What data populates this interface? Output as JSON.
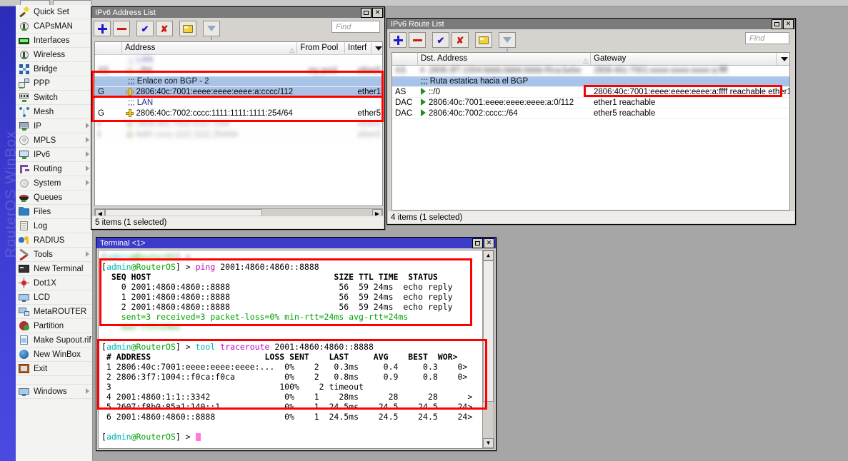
{
  "desktop": {
    "watermark": "RouterOS WinBox"
  },
  "sidebar": {
    "items": [
      {
        "label": "Quick Set",
        "icon": "wand-icon",
        "arrow": false
      },
      {
        "label": "CAPsMAN",
        "icon": "disc-icon",
        "arrow": false
      },
      {
        "label": "Interfaces",
        "icon": "network-card-icon",
        "arrow": false
      },
      {
        "label": "Wireless",
        "icon": "disc-icon",
        "arrow": false
      },
      {
        "label": "Bridge",
        "icon": "bridge-icon",
        "arrow": false
      },
      {
        "label": "PPP",
        "icon": "ppp-icon",
        "arrow": false
      },
      {
        "label": "Switch",
        "icon": "switch-icon",
        "arrow": false
      },
      {
        "label": "Mesh",
        "icon": "mesh-icon",
        "arrow": false
      },
      {
        "label": "IP",
        "icon": "ip-icon",
        "arrow": true
      },
      {
        "label": "MPLS",
        "icon": "mpls-icon",
        "arrow": true
      },
      {
        "label": "IPv6",
        "icon": "ipv6-icon",
        "arrow": true
      },
      {
        "label": "Routing",
        "icon": "routing-icon",
        "arrow": true
      },
      {
        "label": "System",
        "icon": "system-icon",
        "arrow": true
      },
      {
        "label": "Queues",
        "icon": "queues-icon",
        "arrow": false
      },
      {
        "label": "Files",
        "icon": "files-icon",
        "arrow": false
      },
      {
        "label": "Log",
        "icon": "log-icon",
        "arrow": false
      },
      {
        "label": "RADIUS",
        "icon": "radius-icon",
        "arrow": false
      },
      {
        "label": "Tools",
        "icon": "tools-icon",
        "arrow": true
      },
      {
        "label": "New Terminal",
        "icon": "terminal-icon",
        "arrow": false
      },
      {
        "label": "Dot1X",
        "icon": "dot1x-icon",
        "arrow": false
      },
      {
        "label": "LCD",
        "icon": "lcd-icon",
        "arrow": false
      },
      {
        "label": "MetaROUTER",
        "icon": "metarouter-icon",
        "arrow": false
      },
      {
        "label": "Partition",
        "icon": "partition-icon",
        "arrow": false
      },
      {
        "label": "Make Supout.rif",
        "icon": "supout-icon",
        "arrow": false
      },
      {
        "label": "New WinBox",
        "icon": "winbox-icon",
        "arrow": false
      },
      {
        "label": "Exit",
        "icon": "exit-icon",
        "arrow": false
      },
      {
        "label": "Windows",
        "icon": "windows-icon",
        "arrow": true
      }
    ]
  },
  "address_window": {
    "title": "IPv6 Address List",
    "toolbar": {
      "add": "+",
      "remove": "-",
      "enable": "✔",
      "disable": "✘",
      "comment": "comment-folder",
      "filter": "filter-funnel",
      "find_placeholder": "Find"
    },
    "columns": [
      "",
      "Address",
      "From Pool",
      "Interf"
    ],
    "rows": [
      {
        "type": "comment",
        "flags": "",
        "text": ";;; LAN",
        "blur": true
      },
      {
        "type": "data",
        "flags": "XS",
        "address": "::/64",
        "pool": "my pool",
        "iface": "ether5",
        "blur": true,
        "sel": false
      },
      {
        "type": "comment",
        "flags": "",
        "text": ";;; Enlace con BGP - 2",
        "blur": false,
        "sel": true
      },
      {
        "type": "data",
        "flags": "G",
        "address": "2806:40c:7001:eeee:eeee:eeee:a:cccc/112",
        "pool": "",
        "iface": "ether1",
        "blur": false,
        "sel": true
      },
      {
        "type": "comment",
        "flags": "",
        "text": ";;; LAN",
        "blur": false,
        "sel": false
      },
      {
        "type": "data",
        "flags": "G",
        "address": "2806:40c:7002:cccc:1111:1111:1111:254/64",
        "pool": "",
        "iface": "ether5",
        "blur": false,
        "sel": false
      },
      {
        "type": "data",
        "flags": "I",
        "address": "",
        "pool": "",
        "iface": "",
        "blur": true,
        "sel": false
      },
      {
        "type": "data",
        "flags": "I",
        "address": "",
        "pool": "",
        "iface": "",
        "blur": true,
        "sel": false
      }
    ],
    "status": "5 items (1 selected)"
  },
  "route_window": {
    "title": "IPv6 Route List",
    "toolbar": {
      "find_placeholder": "Find"
    },
    "columns": [
      "",
      "Dst. Address",
      "Gateway"
    ],
    "rows": [
      {
        "type": "data",
        "flags": "XS",
        "dst": "2806:3f7:1004:bbbb:bbbb:bbbb:f0ca:bebe",
        "gw": "2806:40c:7001:eeee:eeee:eeee:a:ffff",
        "blur": true,
        "sel": false,
        "tri": "gray"
      },
      {
        "type": "comment",
        "text": ";;; Ruta estatica hacia el BGP",
        "sel": true
      },
      {
        "type": "data",
        "flags": "AS",
        "dst": "::/0",
        "gw": "2806:40c:7001:eeee:eeee:eeee:a:ffff reachable ether1",
        "blur": false,
        "sel": false,
        "tri": "green"
      },
      {
        "type": "data",
        "flags": "DAC",
        "dst": "2806:40c:7001:eeee:eeee:eeee:a:0/112",
        "gw": "ether1 reachable",
        "blur": false,
        "sel": false,
        "tri": "green"
      },
      {
        "type": "data",
        "flags": "DAC",
        "dst": "2806:40c:7002:cccc::/64",
        "gw": "ether5 reachable",
        "blur": false,
        "sel": false,
        "tri": "green"
      }
    ],
    "status": "4 items (1 selected)"
  },
  "terminal": {
    "title": "Terminal <1>",
    "lines": [
      {
        "kind": "prompt_cmd",
        "prompt": "[admin@RouterOS] > ",
        "cmd": "",
        "args": "",
        "blur": true
      },
      {
        "kind": "prompt_cmd",
        "prompt": "[admin@RouterOS] > ",
        "cmd": "ping",
        "args": " 2001:4860:4860::8888"
      },
      {
        "kind": "header",
        "text": "  SEQ HOST                                     SIZE TTL TIME  STATUS"
      },
      {
        "kind": "plain",
        "text": "    0 2001:4860:4860::8888                      56  59 24ms  echo reply"
      },
      {
        "kind": "plain",
        "text": "    1 2001:4860:4860::8888                      56  59 24ms  echo reply"
      },
      {
        "kind": "plain",
        "text": "    2 2001:4860:4860::8888                      56  59 24ms  echo reply"
      },
      {
        "kind": "stat",
        "text": "    sent=3 received=3 packet-loss=0% min-rtt=24ms avg-rtt=24ms"
      },
      {
        "kind": "stat",
        "text": "    max-rtt=24ms"
      },
      {
        "kind": "blank",
        "text": ""
      },
      {
        "kind": "prompt_cmd",
        "prompt": "[admin@RouterOS] > ",
        "cmd": "tool",
        "cmd2": "traceroute",
        "args": " 2001:4860:4860::8888"
      },
      {
        "kind": "header",
        "text": " # ADDRESS                       LOSS SENT    LAST     AVG    BEST  WOR>"
      },
      {
        "kind": "plain",
        "text": " 1 2806:40c:7001:eeee:eeee:eeee:...  0%    2   0.3ms     0.4     0.3    0>"
      },
      {
        "kind": "plain",
        "text": " 2 2806:3f7:1004::f0ca:f0ca          0%    2   0.8ms     0.9     0.8    0>"
      },
      {
        "kind": "plain",
        "text": " 3                                  100%    2 timeout"
      },
      {
        "kind": "plain",
        "text": " 4 2001:4860:1:1::3342               0%    1    28ms      28      28      >"
      },
      {
        "kind": "plain",
        "text": " 5 2607:f8b0:85a1:140::1             0%    1  24.5ms    24.5    24.5    24>"
      },
      {
        "kind": "plain",
        "text": " 6 2001:4860:4860::8888              0%    1  24.5ms    24.5    24.5    24>"
      },
      {
        "kind": "blank",
        "text": ""
      },
      {
        "kind": "prompt_cursor",
        "prompt": "[admin@RouterOS] > "
      }
    ]
  },
  "colors": {
    "accent_titlebar_active": "#3b3bc8",
    "accent_titlebar_inactive": "#7b7b7b",
    "selection": "#a9c3e8",
    "annotation": "#ff0000",
    "desktop": "#a6a6a6"
  }
}
